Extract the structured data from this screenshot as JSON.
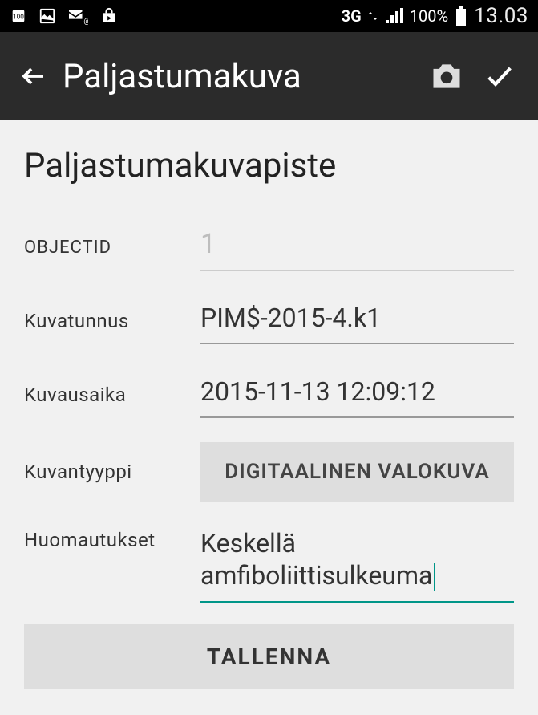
{
  "status_bar": {
    "network_label": "3G",
    "battery_pct": "100%",
    "time": "13.03"
  },
  "app_bar": {
    "title": "Paljastumakuva"
  },
  "page": {
    "heading": "Paljastumakuvapiste"
  },
  "fields": {
    "objectid": {
      "label": "OBJECTID",
      "value": "1"
    },
    "kuvatunnus": {
      "label": "Kuvatunnus",
      "value": "PIM$-2015-4.k1"
    },
    "kuvausaika": {
      "label": "Kuvausaika",
      "value": "2015-11-13 12:09:12"
    },
    "kuvantyyppi": {
      "label": "Kuvantyyppi",
      "value": "DIGITAALINEN VALOKUVA"
    },
    "huomautukset": {
      "label": "Huomautukset",
      "value": "Keskellä amfiboliittisulkeuma"
    }
  },
  "buttons": {
    "save": "TALLENNA"
  }
}
